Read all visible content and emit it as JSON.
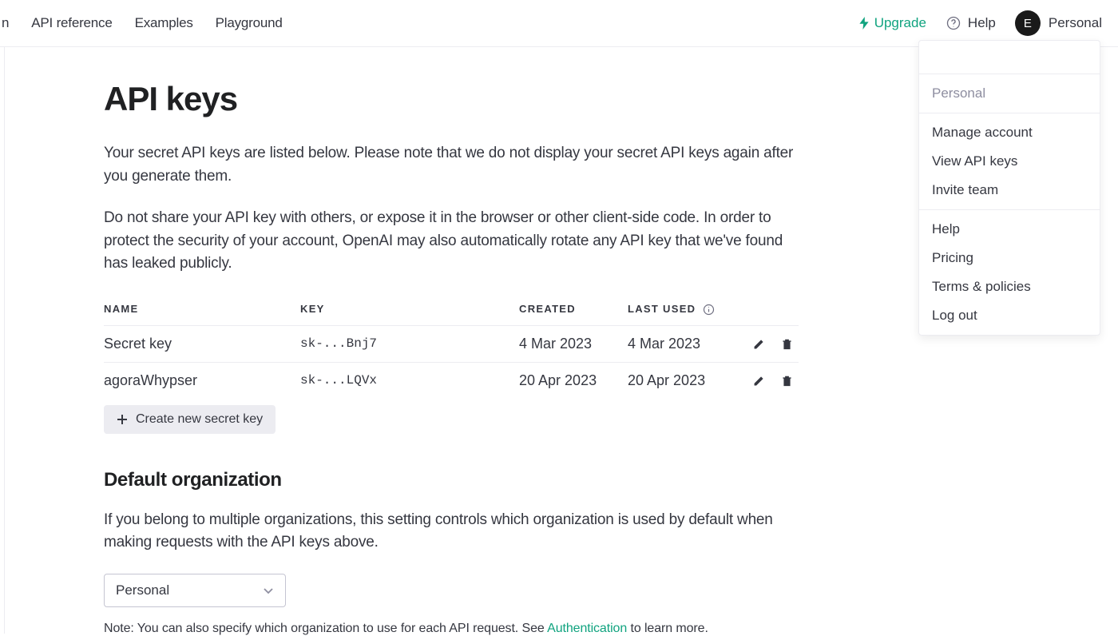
{
  "nav": {
    "truncated": "n",
    "links": [
      "API reference",
      "Examples",
      "Playground"
    ]
  },
  "topright": {
    "upgrade": "Upgrade",
    "help": "Help",
    "avatar_initial": "E",
    "account_label": "Personal"
  },
  "page": {
    "title": "API keys",
    "para1": "Your secret API keys are listed below. Please note that we do not display your secret API keys again after you generate them.",
    "para2": "Do not share your API key with others, or expose it in the browser or other client-side code. In order to protect the security of your account, OpenAI may also automatically rotate any API key that we've found has leaked publicly."
  },
  "table": {
    "headers": {
      "name": "NAME",
      "key": "KEY",
      "created": "CREATED",
      "last_used": "LAST USED"
    },
    "rows": [
      {
        "name": "Secret key",
        "key": "sk-...Bnj7",
        "created": "4 Mar 2023",
        "last_used": "4 Mar 2023"
      },
      {
        "name": "agoraWhypser",
        "key": "sk-...LQVx",
        "created": "20 Apr 2023",
        "last_used": "20 Apr 2023"
      }
    ]
  },
  "create_button": "Create new secret key",
  "default_org": {
    "heading": "Default organization",
    "para": "If you belong to multiple organizations, this setting controls which organization is used by default when making requests with the API keys above.",
    "selected": "Personal",
    "note_prefix": "Note: You can also specify which organization to use for each API request. See ",
    "note_link": "Authentication",
    "note_suffix": " to learn more."
  },
  "dropdown": {
    "org_label": "Personal",
    "group1": [
      "Manage account",
      "View API keys",
      "Invite team"
    ],
    "group2": [
      "Help",
      "Pricing",
      "Terms & policies",
      "Log out"
    ]
  }
}
